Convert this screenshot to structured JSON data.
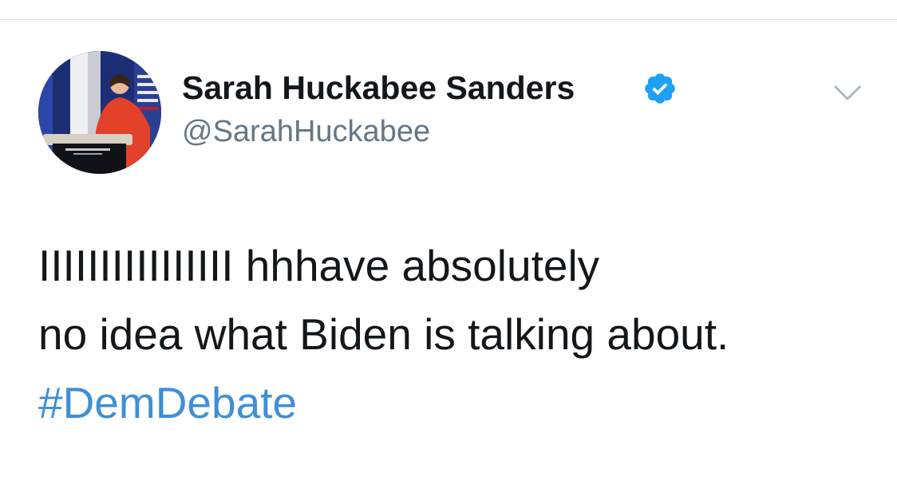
{
  "tweet": {
    "author": {
      "display_name": "Sarah Huckabee Sanders",
      "handle": "@SarahHuckabee",
      "verified": true,
      "verified_icon": "verified-badge-icon",
      "avatar_icon": "profile-photo-podium"
    },
    "menu_icon": "chevron-down-icon",
    "text_line_1": "IIIIIIIIIIIIIIII hhhave absolutely",
    "text_line_2": "no idea what Biden is talking about.",
    "hashtag": "#DemDebate"
  },
  "colors": {
    "text_primary": "#14171a",
    "text_secondary": "#657786",
    "link": "#3e8fd7",
    "verified": "#1da1f2",
    "divider": "#d7dde2"
  }
}
